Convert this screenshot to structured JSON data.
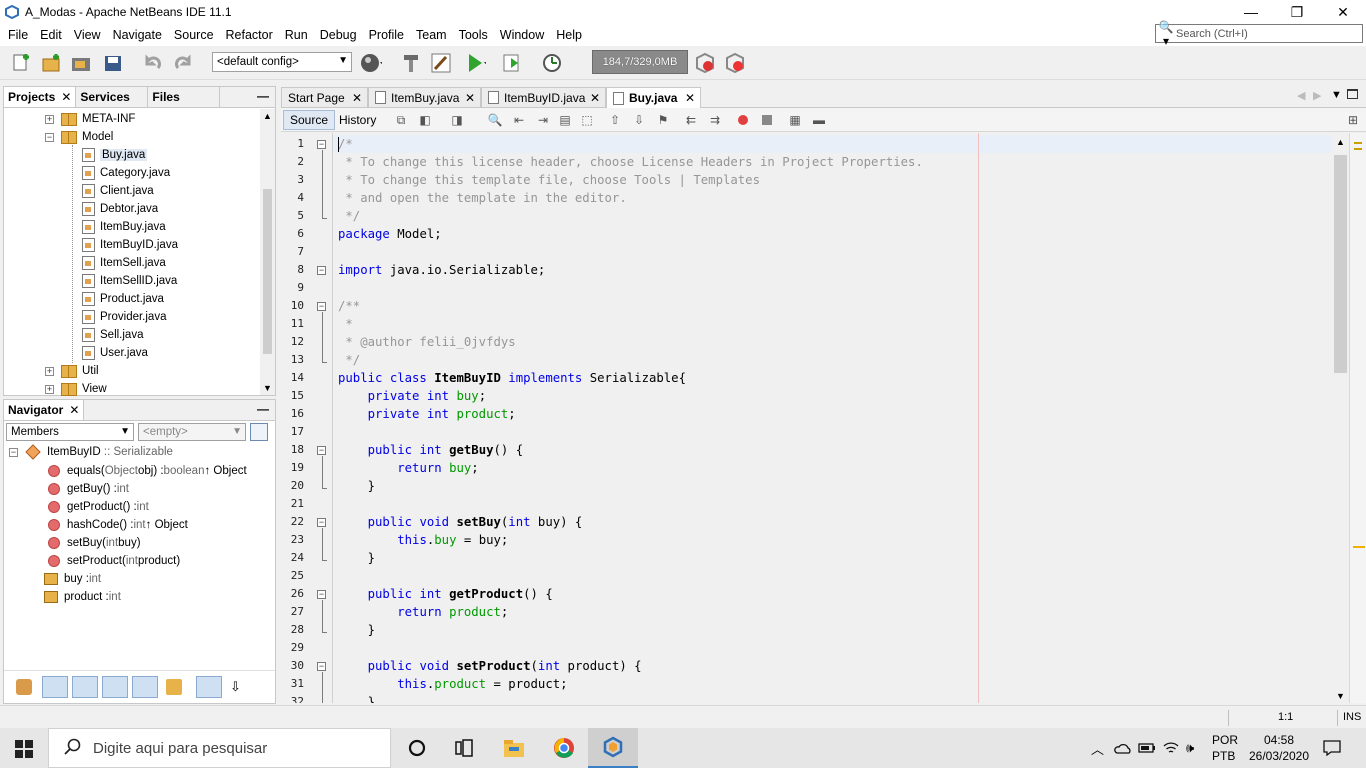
{
  "window": {
    "title": "A_Modas - Apache NetBeans IDE 11.1",
    "minimize": "—",
    "maximize": "❐",
    "close": "✕"
  },
  "menu": [
    "File",
    "Edit",
    "View",
    "Navigate",
    "Source",
    "Refactor",
    "Run",
    "Debug",
    "Profile",
    "Team",
    "Tools",
    "Window",
    "Help"
  ],
  "search": {
    "placeholder": "Search (Ctrl+I)"
  },
  "toolbar": {
    "config": "<default config>",
    "memory": "184,7/329,0MB"
  },
  "projects_panel": {
    "tabs": [
      "Projects",
      "Services",
      "Files"
    ],
    "tree": [
      {
        "label": "META-INF",
        "type": "folder",
        "expander": "+"
      },
      {
        "label": "Model",
        "type": "folder",
        "expander": "−"
      },
      {
        "label": "Buy.java",
        "type": "file",
        "selected": true
      },
      {
        "label": "Category.java",
        "type": "file"
      },
      {
        "label": "Client.java",
        "type": "file"
      },
      {
        "label": "Debtor.java",
        "type": "file"
      },
      {
        "label": "ItemBuy.java",
        "type": "file"
      },
      {
        "label": "ItemBuyID.java",
        "type": "file"
      },
      {
        "label": "ItemSell.java",
        "type": "file"
      },
      {
        "label": "ItemSellID.java",
        "type": "file"
      },
      {
        "label": "Product.java",
        "type": "file"
      },
      {
        "label": "Provider.java",
        "type": "file"
      },
      {
        "label": "Sell.java",
        "type": "file"
      },
      {
        "label": "User.java",
        "type": "file"
      },
      {
        "label": "Util",
        "type": "folder",
        "expander": "+"
      },
      {
        "label": "View",
        "type": "folder",
        "expander": "+"
      }
    ]
  },
  "navigator": {
    "title": "Navigator",
    "members_combo": "Members",
    "filter_combo": "<empty>",
    "root": {
      "name": "ItemBuyID",
      "suffix": " :: Serializable"
    },
    "members": [
      {
        "name": "equals(",
        "param_type": "Object",
        "param": " obj) : ",
        "ret": "boolean",
        "extra": " ↑ Object",
        "kind": "method"
      },
      {
        "name": "getBuy() : ",
        "ret": "int",
        "kind": "method"
      },
      {
        "name": "getProduct() : ",
        "ret": "int",
        "kind": "method"
      },
      {
        "name": "hashCode() : ",
        "ret": "int",
        "extra": " ↑ Object",
        "kind": "method"
      },
      {
        "name": "setBuy(",
        "param_type": "int",
        "param": " buy)",
        "kind": "method"
      },
      {
        "name": "setProduct(",
        "param_type": "int",
        "param": " product)",
        "kind": "method"
      },
      {
        "name": "buy : ",
        "ret": "int",
        "kind": "field"
      },
      {
        "name": "product : ",
        "ret": "int",
        "kind": "field"
      }
    ]
  },
  "editor": {
    "tabs": [
      {
        "label": "Start Page",
        "active": false
      },
      {
        "label": "ItemBuy.java",
        "active": false
      },
      {
        "label": "ItemBuyID.java",
        "active": false
      },
      {
        "label": "Buy.java",
        "active": true
      }
    ],
    "subtabs": [
      "Source",
      "History"
    ],
    "lines": [
      [
        [
          "cm",
          "/*"
        ]
      ],
      [
        [
          "cm",
          " * To change this license header, choose License Headers in Project Properties."
        ]
      ],
      [
        [
          "cm",
          " * To change this template file, choose Tools | Templates"
        ]
      ],
      [
        [
          "cm",
          " * and open the template in the editor."
        ]
      ],
      [
        [
          "cm",
          " */"
        ]
      ],
      [
        [
          "kw",
          "package"
        ],
        [
          "",
          " Model;"
        ]
      ],
      [],
      [
        [
          "kw",
          "import"
        ],
        [
          "",
          " java.io.Serializable;"
        ]
      ],
      [],
      [
        [
          "cm",
          "/**"
        ]
      ],
      [
        [
          "cm",
          " *"
        ]
      ],
      [
        [
          "cm",
          " * @author felii_0jvfdys"
        ]
      ],
      [
        [
          "cm",
          " */"
        ]
      ],
      [
        [
          "kw",
          "public class"
        ],
        [
          "",
          " "
        ],
        [
          "bold",
          "ItemBuyID"
        ],
        [
          "",
          " "
        ],
        [
          "kw",
          "implements"
        ],
        [
          "",
          " Serializable{"
        ]
      ],
      [
        [
          "",
          "    "
        ],
        [
          "kw",
          "private int"
        ],
        [
          "",
          " "
        ],
        [
          "fld",
          "buy"
        ],
        [
          "",
          ";"
        ]
      ],
      [
        [
          "",
          "    "
        ],
        [
          "kw",
          "private int"
        ],
        [
          "",
          " "
        ],
        [
          "fld",
          "product"
        ],
        [
          "",
          ";"
        ]
      ],
      [],
      [
        [
          "",
          "    "
        ],
        [
          "kw",
          "public int"
        ],
        [
          "",
          " "
        ],
        [
          "bold",
          "getBuy"
        ],
        [
          "",
          "() {"
        ]
      ],
      [
        [
          "",
          "        "
        ],
        [
          "kw",
          "return"
        ],
        [
          "",
          " "
        ],
        [
          "fld",
          "buy"
        ],
        [
          "",
          ";"
        ]
      ],
      [
        [
          "",
          "    }"
        ]
      ],
      [],
      [
        [
          "",
          "    "
        ],
        [
          "kw",
          "public void"
        ],
        [
          "",
          " "
        ],
        [
          "bold",
          "setBuy"
        ],
        [
          "",
          "("
        ],
        [
          "kw",
          "int"
        ],
        [
          "",
          " buy) {"
        ]
      ],
      [
        [
          "",
          "        "
        ],
        [
          "kw",
          "this"
        ],
        [
          "",
          "."
        ],
        [
          "fld",
          "buy"
        ],
        [
          "",
          " = buy;"
        ]
      ],
      [
        [
          "",
          "    }"
        ]
      ],
      [],
      [
        [
          "",
          "    "
        ],
        [
          "kw",
          "public int"
        ],
        [
          "",
          " "
        ],
        [
          "bold",
          "getProduct"
        ],
        [
          "",
          "() {"
        ]
      ],
      [
        [
          "",
          "        "
        ],
        [
          "kw",
          "return"
        ],
        [
          "",
          " "
        ],
        [
          "fld",
          "product"
        ],
        [
          "",
          ";"
        ]
      ],
      [
        [
          "",
          "    }"
        ]
      ],
      [],
      [
        [
          "",
          "    "
        ],
        [
          "kw",
          "public void"
        ],
        [
          "",
          " "
        ],
        [
          "bold",
          "setProduct"
        ],
        [
          "",
          "("
        ],
        [
          "kw",
          "int"
        ],
        [
          "",
          " product) {"
        ]
      ],
      [
        [
          "",
          "        "
        ],
        [
          "kw",
          "this"
        ],
        [
          "",
          "."
        ],
        [
          "fld",
          "product"
        ],
        [
          "",
          " = product;"
        ]
      ],
      [
        [
          "",
          "    }"
        ]
      ]
    ],
    "line_numbers": [
      "1",
      "2",
      "3",
      "4",
      "5",
      "6",
      "7",
      "8",
      "9",
      "10",
      "11",
      "12",
      "13",
      "14",
      "15",
      "16",
      "17",
      "18",
      "19",
      "20",
      "21",
      "22",
      "23",
      "24",
      "25",
      "26",
      "27",
      "28",
      "29",
      "30",
      "31",
      "32"
    ]
  },
  "statusbar": {
    "position": "1:1",
    "mode": "INS"
  },
  "taskbar": {
    "search_placeholder": "Digite aqui para pesquisar",
    "lang_top": "POR",
    "lang_bottom": "PTB",
    "time": "04:58",
    "date": "26/03/2020"
  },
  "colors": {
    "keyword": "#0000e6",
    "comment": "#969696",
    "field": "#009900",
    "selection": "#dfe8f3"
  }
}
